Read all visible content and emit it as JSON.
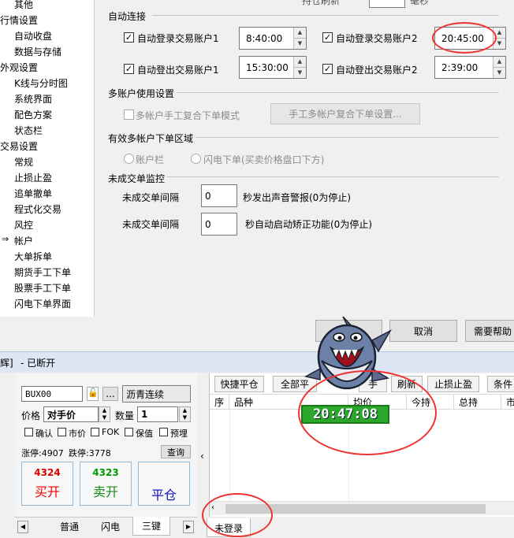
{
  "tree": {
    "items": [
      {
        "label": "其他",
        "indent": 1
      },
      {
        "label": "行情设置",
        "indent": 0
      },
      {
        "label": "自动收盘",
        "indent": 1
      },
      {
        "label": "数据与存储",
        "indent": 1
      },
      {
        "label": "外观设置",
        "indent": 0
      },
      {
        "label": "K线与分时图",
        "indent": 1
      },
      {
        "label": "系统界面",
        "indent": 1
      },
      {
        "label": "配色方案",
        "indent": 1
      },
      {
        "label": "状态栏",
        "indent": 1
      },
      {
        "label": "交易设置",
        "indent": 0
      },
      {
        "label": "常规",
        "indent": 1
      },
      {
        "label": "止损止盈",
        "indent": 1
      },
      {
        "label": "追单撤单",
        "indent": 1
      },
      {
        "label": "程式化交易",
        "indent": 1
      },
      {
        "label": "风控",
        "indent": 1
      },
      {
        "label": "帐户",
        "indent": 1,
        "selected": true
      },
      {
        "label": "大单拆单",
        "indent": 1
      },
      {
        "label": "期货手工下单",
        "indent": 1
      },
      {
        "label": "股票手工下单",
        "indent": 1
      },
      {
        "label": "闪电下单界面",
        "indent": 1
      }
    ]
  },
  "settings": {
    "top_partial_label": "持仓刷新",
    "top_partial_unit": "毫秒",
    "auto_connect": {
      "title": "自动连接",
      "login1": {
        "label": "自动登录交易账户1",
        "time": "8:40:00"
      },
      "login2": {
        "label": "自动登录交易账户2",
        "time": "20:45:00"
      },
      "logout1": {
        "label": "自动登出交易账户1",
        "time": "15:30:00"
      },
      "logout2": {
        "label": "自动登出交易账户2",
        "time": "2:39:00"
      }
    },
    "multi_account": {
      "title": "多账户使用设置",
      "manual_mode_label": "多帐户手工复合下单模式",
      "manual_settings_button": "手工多帐户复合下单设置..."
    },
    "order_area": {
      "title": "有效多帐户下单区域",
      "option1": "账户栏",
      "option2": "闪电下单(买卖价格盘口下方)"
    },
    "unfilled": {
      "title": "未成交单监控",
      "row1_label": "未成交单间隔",
      "row1_value": "0",
      "row1_desc": "秒发出声音警报(0为停止)",
      "row2_label": "未成交单间隔",
      "row2_value": "0",
      "row2_desc": "秒自动启动矫正功能(0为停止)"
    },
    "buttons": {
      "cancel": "取消",
      "help": "需要帮助"
    }
  },
  "trading": {
    "title_prefix": "辉]",
    "title_status": "- 已断开",
    "symbol": "BUX00",
    "symbol_name": "沥青连续",
    "price_label": "价格",
    "price_value": "对手价",
    "qty_label": "数量",
    "qty_value": "1",
    "checks": [
      "确认",
      "市价",
      "FOK",
      "保值",
      "预埋"
    ],
    "limit_up": "涨停:4907",
    "limit_down": "跌停:3778",
    "query_button": "查询",
    "buy": {
      "price": "4324",
      "label": "买开"
    },
    "sell": {
      "price": "4323",
      "label": "卖开"
    },
    "close": {
      "label": "平仓"
    },
    "tabs": [
      "普通",
      "闪电",
      "三键"
    ],
    "status": "未登录"
  },
  "positions": {
    "toolbar": [
      "快捷平仓",
      "全部平",
      "手",
      "刷新",
      "止损止盈",
      "条件"
    ],
    "columns": [
      "序",
      "品种",
      "均价",
      "今持",
      "总持",
      "市"
    ],
    "clock": "20:47:08"
  }
}
